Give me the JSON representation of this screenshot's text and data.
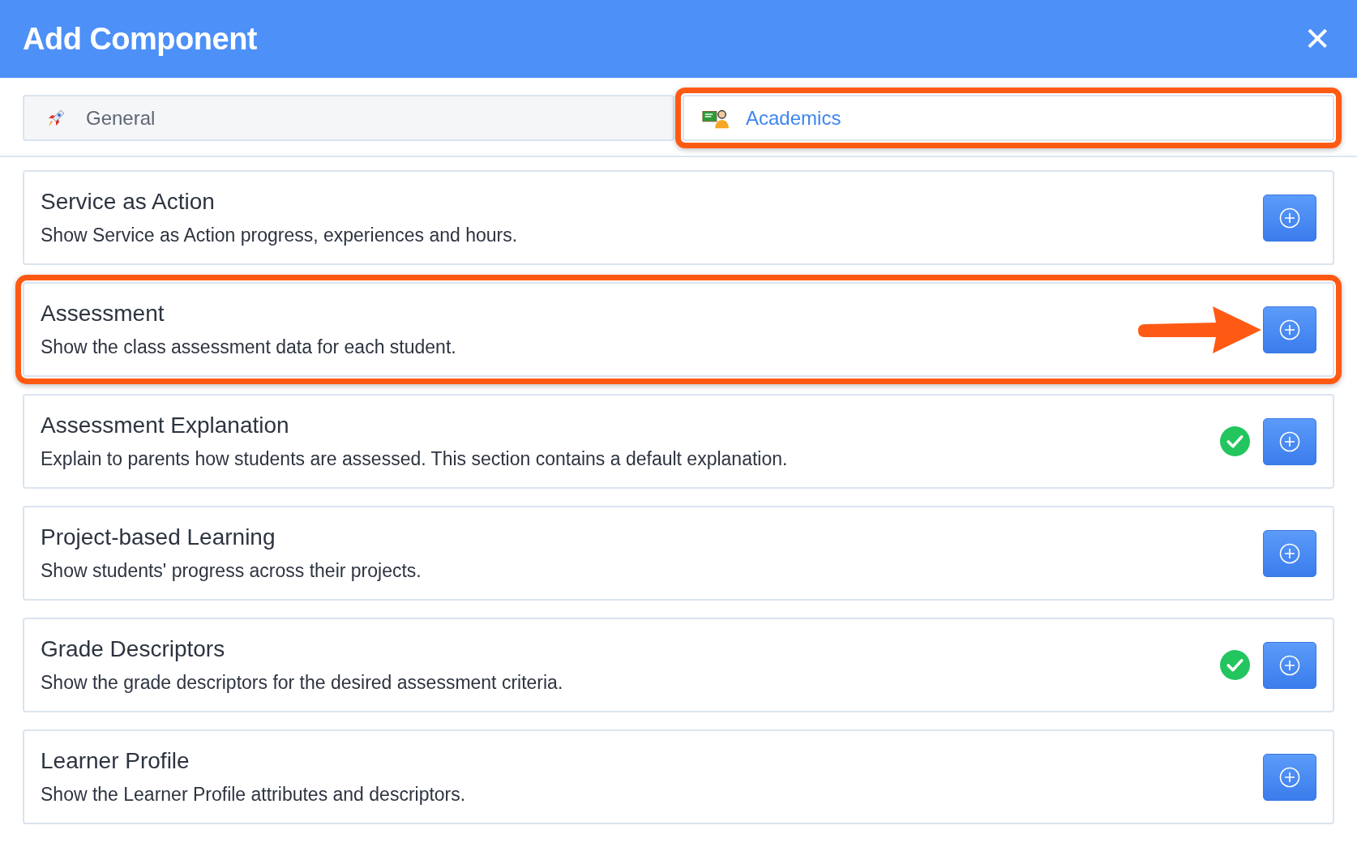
{
  "header": {
    "title": "Add Component",
    "close_label": "✕"
  },
  "tabs": [
    {
      "label": "General",
      "kind": "rocket",
      "selected": false,
      "highlighted": false
    },
    {
      "label": "Academics",
      "kind": "teacher",
      "selected": true,
      "highlighted": true
    }
  ],
  "components": [
    {
      "title": "Service as Action",
      "description": "Show Service as Action progress, experiences and hours.",
      "added": false,
      "highlighted": false,
      "pointer_arrow": false
    },
    {
      "title": "Assessment",
      "description": "Show the class assessment data for each student.",
      "added": false,
      "highlighted": true,
      "pointer_arrow": true
    },
    {
      "title": "Assessment Explanation",
      "description": "Explain to parents how students are assessed. This section contains a default explanation.",
      "added": true,
      "highlighted": false,
      "pointer_arrow": false
    },
    {
      "title": "Project-based Learning",
      "description": "Show students' progress across their projects.",
      "added": false,
      "highlighted": false,
      "pointer_arrow": false
    },
    {
      "title": "Grade Descriptors",
      "description": "Show the grade descriptors for the desired assessment criteria.",
      "added": true,
      "highlighted": false,
      "pointer_arrow": false
    },
    {
      "title": "Learner Profile",
      "description": "Show the Learner Profile attributes and descriptors.",
      "added": false,
      "highlighted": false,
      "pointer_arrow": false
    }
  ]
}
